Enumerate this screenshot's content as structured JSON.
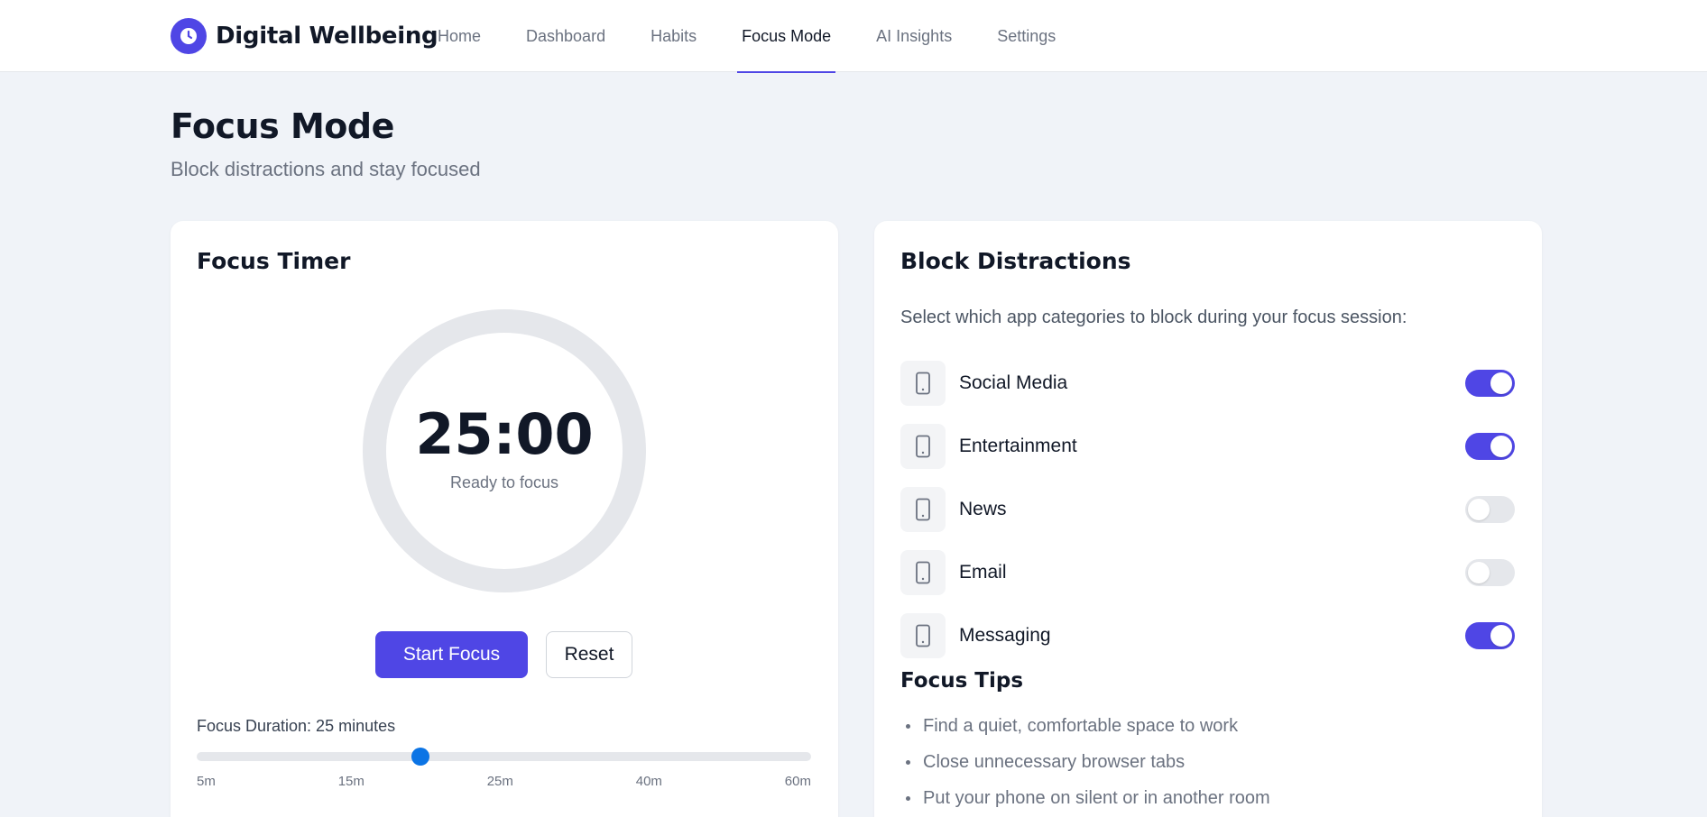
{
  "brand": {
    "name": "Digital Wellbeing",
    "logo_icon": "clock-icon",
    "accent": "#4f46e5"
  },
  "nav": {
    "items": [
      {
        "label": "Home",
        "active": false
      },
      {
        "label": "Dashboard",
        "active": false
      },
      {
        "label": "Habits",
        "active": false
      },
      {
        "label": "Focus Mode",
        "active": true
      },
      {
        "label": "AI Insights",
        "active": false
      },
      {
        "label": "Settings",
        "active": false
      }
    ]
  },
  "header": {
    "title": "Focus Mode",
    "subtitle": "Block distractions and stay focused"
  },
  "timer": {
    "title": "Focus Timer",
    "time": "25:00",
    "status": "Ready to focus",
    "start_label": "Start Focus",
    "reset_label": "Reset",
    "duration_label": "Focus Duration: 25 minutes",
    "duration_minutes": 25,
    "min_minutes": 5,
    "max_minutes": 60,
    "ticks": [
      "5m",
      "15m",
      "25m",
      "40m",
      "60m"
    ],
    "slider_color": "#0b74e5"
  },
  "block": {
    "title": "Block Distractions",
    "description": "Select which app categories to block during your focus session:",
    "categories": [
      {
        "label": "Social Media",
        "icon": "phone-icon",
        "enabled": true
      },
      {
        "label": "Entertainment",
        "icon": "phone-icon",
        "enabled": true
      },
      {
        "label": "News",
        "icon": "phone-icon",
        "enabled": false
      },
      {
        "label": "Email",
        "icon": "phone-icon",
        "enabled": false
      },
      {
        "label": "Messaging",
        "icon": "phone-icon",
        "enabled": true
      }
    ]
  },
  "tips": {
    "title": "Focus Tips",
    "items": [
      "Find a quiet, comfortable space to work",
      "Close unnecessary browser tabs",
      "Put your phone on silent or in another room"
    ]
  }
}
